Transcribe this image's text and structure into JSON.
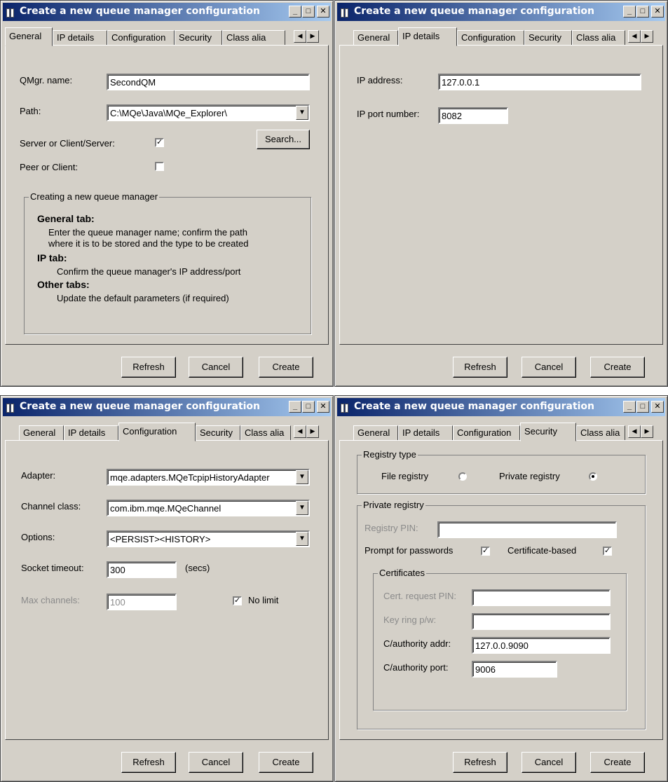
{
  "window_title": "Create a new queue manager configuration",
  "tabs": [
    "General",
    "IP details",
    "Configuration",
    "Security",
    "Class alia"
  ],
  "buttons": {
    "refresh": "Refresh",
    "cancel": "Cancel",
    "create": "Create"
  },
  "general": {
    "qmgr_label": "QMgr. name:",
    "qmgr_value": "SecondQM",
    "path_label": "Path:",
    "path_value": "C:\\MQe\\Java\\MQe_Explorer\\",
    "search_label": "Search...",
    "server_label": "Server or Client/Server:",
    "server_checked": true,
    "peer_label": "Peer or Client:",
    "peer_checked": false,
    "help_group": "Creating a new queue manager",
    "help_general_title": "General tab:",
    "help_general_text1": "Enter the queue manager name; confirm the path",
    "help_general_text2": "where it is to be stored and the type to be created",
    "help_ip_title": "IP tab:",
    "help_ip_text": "Confirm the queue manager's IP address/port",
    "help_other_title": "Other tabs:",
    "help_other_text": "Update the default parameters (if required)"
  },
  "ip": {
    "address_label": "IP address:",
    "address_value": "127.0.0.1",
    "port_label": "IP port number:",
    "port_value": "8082"
  },
  "configuration": {
    "adapter_label": "Adapter:",
    "adapter_value": "mqe.adapters.MQeTcpipHistoryAdapter",
    "channel_label": "Channel class:",
    "channel_value": "com.ibm.mqe.MQeChannel",
    "options_label": "Options:",
    "options_value": "<PERSIST><HISTORY>",
    "socket_label": "Socket timeout:",
    "socket_value": "300",
    "socket_unit": "(secs)",
    "maxch_label": "Max channels:",
    "maxch_value": "100",
    "nolimit_label": "No limit",
    "nolimit_checked": true
  },
  "security": {
    "registry_group": "Registry type",
    "file_registry_label": "File registry",
    "private_registry_label": "Private registry",
    "selected_registry": "Private registry",
    "private_group": "Private registry",
    "pin_label": "Registry PIN:",
    "pin_value": "",
    "prompt_label": "Prompt for passwords",
    "prompt_checked": true,
    "certbased_label": "Certificate-based",
    "certbased_checked": true,
    "cert_group": "Certificates",
    "cert_pin_label": "Cert. request PIN:",
    "cert_pin_value": "",
    "keyring_label": "Key ring p/w:",
    "keyring_value": "",
    "ca_addr_label": "C/authority addr:",
    "ca_addr_value": "127.0.0.9090",
    "ca_port_label": "C/authority port:",
    "ca_port_value": "9006"
  },
  "checkmark": "✓",
  "icons": [
    "app-icon",
    "minimize-icon",
    "maximize-icon",
    "close-icon",
    "scroll-left-icon",
    "scroll-right-icon",
    "dropdown-arrow-icon"
  ]
}
